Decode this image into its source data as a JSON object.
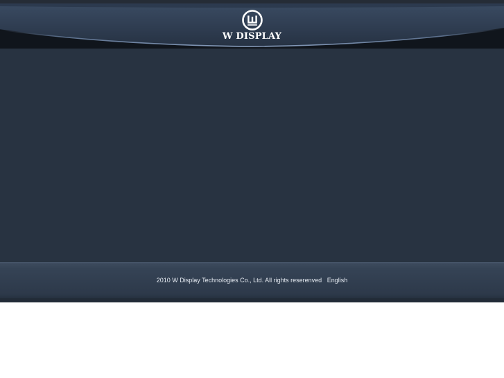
{
  "header": {
    "logo": {
      "mark_icon": "w-circle-logo-icon",
      "text": "W DISPLAY"
    }
  },
  "footer": {
    "copyright": "2010 W Display Technologies Co., Ltd. All rights reserenved",
    "language_link": "English"
  },
  "colors": {
    "header_bg": "#1b222c",
    "main_bg": "#283341",
    "footer_bg": "#2d394a",
    "text": "#e6ebf2",
    "page_bg": "#ffffff"
  }
}
